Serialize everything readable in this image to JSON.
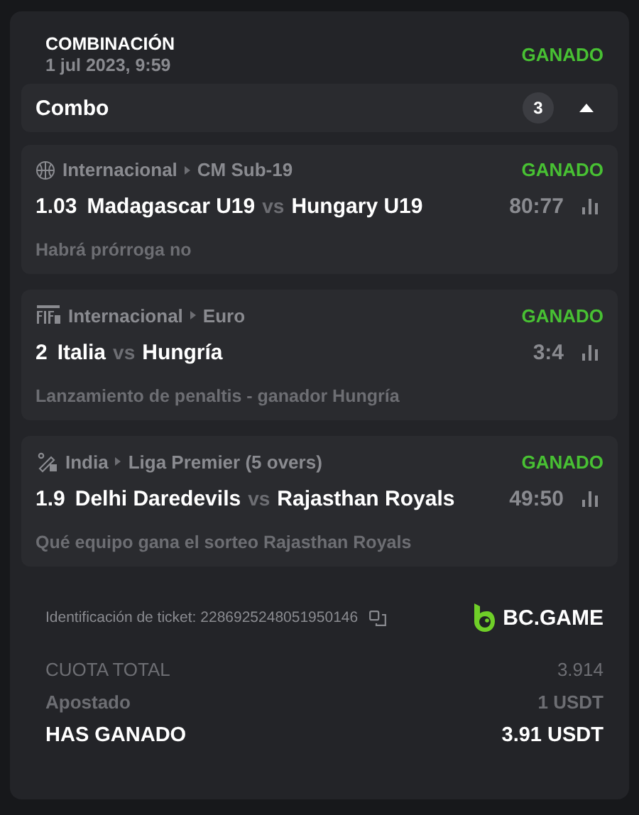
{
  "bet": {
    "type": "COMBINACIÓN",
    "date": "1 jul 2023, 9:59",
    "status": "GANADO"
  },
  "combo": {
    "label": "Combo",
    "count": "3",
    "expanded": true
  },
  "selections": [
    {
      "kind": "basketball",
      "country": "Internacional",
      "league": "CM Sub-19",
      "status": "GANADO",
      "odds": "1.03",
      "home": "Madagascar U19",
      "vs": "vs",
      "away": "Hungary U19",
      "score": "80:77",
      "market": "Habrá prórroga no"
    },
    {
      "kind": "penalty",
      "country": "Internacional",
      "league": "Euro",
      "status": "GANADO",
      "odds": "2",
      "home": "Italia",
      "vs": "vs",
      "away": "Hungría",
      "score": "3:4",
      "market": "Lanzamiento de penaltis - ganador Hungría"
    },
    {
      "kind": "cricket",
      "country": "India",
      "league": "Liga Premier (5 overs)",
      "status": "GANADO",
      "odds": "1.9",
      "home": "Delhi Daredevils",
      "vs": "vs",
      "away": "Rajasthan Royals",
      "score": "49:50",
      "market": "Qué equipo gana el sorteo Rajasthan Royals"
    }
  ],
  "ticket": {
    "label": "Identificación de ticket: 2286925248051950146",
    "brand": "BC.GAME"
  },
  "summary": [
    {
      "kind": "odds",
      "label": "CUOTA TOTAL",
      "value": "3.914"
    },
    {
      "kind": "stake",
      "label": "Apostado",
      "value": "1 USDT"
    },
    {
      "kind": "win",
      "label": "HAS GANADO",
      "value": "3.91 USDT"
    }
  ]
}
